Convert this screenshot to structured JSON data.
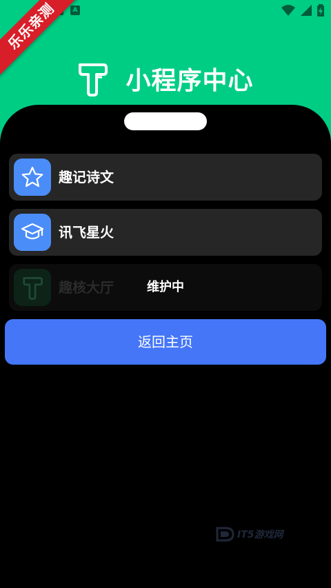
{
  "status_bar": {
    "left_icons": [
      "notification-icon",
      "android-icon"
    ],
    "left_icon_letter": "A",
    "right_icons": [
      "wifi-icon",
      "signal-icon",
      "battery-charging-icon"
    ]
  },
  "ribbon": {
    "text": "乐乐亲测"
  },
  "header": {
    "title": "小程序中心",
    "logo_icon": "hammer-t-icon"
  },
  "items": [
    {
      "label": "趣记诗文",
      "icon": "star-icon",
      "enabled": true
    },
    {
      "label": "讯飞星火",
      "icon": "graduation-cap-icon",
      "enabled": true
    },
    {
      "label": "趣核大厅",
      "icon": "hammer-t-icon",
      "enabled": false,
      "status": "维护中"
    }
  ],
  "back_button": {
    "label": "返回主页"
  },
  "watermark": {
    "text": "IT5游戏网"
  },
  "colors": {
    "header_bg": "#00cd84",
    "card_bg": "#262626",
    "icon_bg": "#4b8df8",
    "button_bg": "#4476f7",
    "ribbon_bg": "#d81e28"
  }
}
